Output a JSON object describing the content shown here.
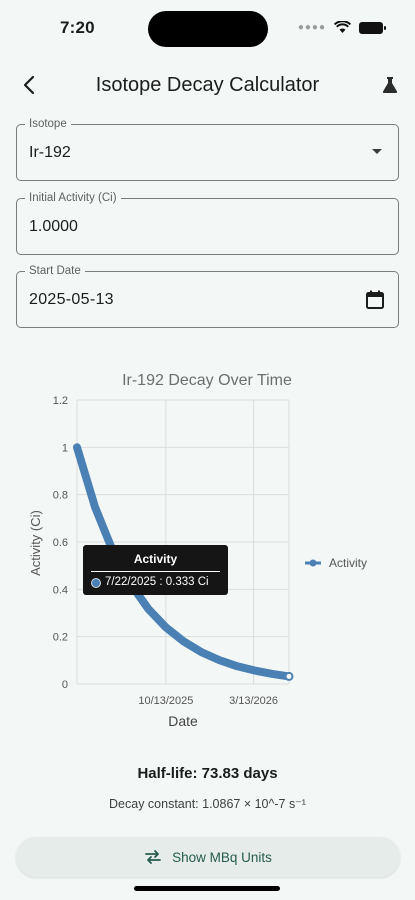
{
  "status_bar": {
    "time": "7:20"
  },
  "app_bar": {
    "title": "Isotope Decay Calculator",
    "back_icon": "chevron-left-icon",
    "action_icon": "flask-icon"
  },
  "form": {
    "isotope": {
      "label": "Isotope",
      "value": "Ir-192"
    },
    "initial_activity": {
      "label": "Initial Activity (Ci)",
      "value": "1.0000"
    },
    "start_date": {
      "label": "Start Date",
      "value": "2025-05-13",
      "icon": "calendar-icon"
    }
  },
  "chart_data": {
    "type": "line",
    "title": "Ir-192 Decay Over Time",
    "xlabel": "Date",
    "ylabel": "Activity (Ci)",
    "x_tick_labels": [
      "10/13/2025",
      "3/13/2026"
    ],
    "y_ticks": [
      0,
      0.2,
      0.4,
      0.6,
      0.8,
      1,
      1.2
    ],
    "ylim": [
      0,
      1.2
    ],
    "xlim": [
      "2025-05-13",
      "2026-05-13"
    ],
    "grid": true,
    "legend_position": "right",
    "series": [
      {
        "name": "Activity",
        "color": "#4a80b4",
        "x": [
          "2025-05-13",
          "2025-06-13",
          "2025-07-13",
          "2025-08-13",
          "2025-09-13",
          "2025-10-13",
          "2025-11-13",
          "2025-12-13",
          "2026-01-13",
          "2026-02-13",
          "2026-03-13",
          "2026-04-13",
          "2026-05-13"
        ],
        "y": [
          1.0,
          0.748,
          0.566,
          0.424,
          0.317,
          0.239,
          0.179,
          0.135,
          0.101,
          0.075,
          0.058,
          0.043,
          0.032
        ]
      }
    ]
  },
  "tooltip": {
    "title": "Activity",
    "text": "7/22/2025 : 0.333 Ci",
    "x": "2025-07-22",
    "y": 0.333
  },
  "results": {
    "half_life": "Half-life: 73.83 days",
    "decay_constant": "Decay constant: 1.0867 × 10^-7 s⁻¹"
  },
  "units_button": {
    "label": "Show MBq Units",
    "icon": "swap-arrows-icon"
  },
  "colors": {
    "background": "#f3f8f6",
    "accent": "#265c4e",
    "series": "#4a80b4"
  }
}
